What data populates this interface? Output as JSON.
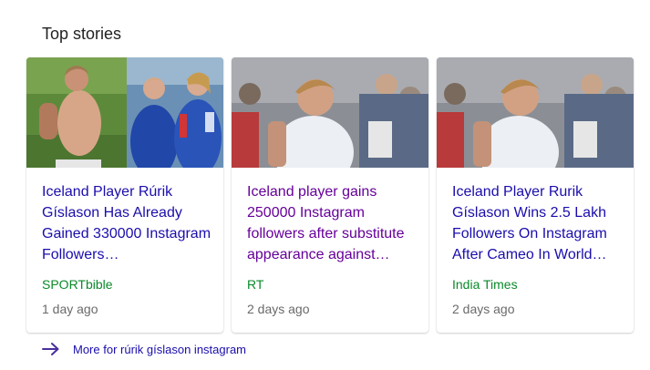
{
  "section": {
    "title": "Top stories"
  },
  "cards": [
    {
      "headline": "Iceland Player Rúrik Gíslason Has Already Gained 330000 Instagram Followers…",
      "source": "SPORTbible",
      "age": "1 day ago",
      "visited": false
    },
    {
      "headline": "Iceland player gains 250000 Instagram followers after substitute appearance against…",
      "source": "RT",
      "age": "2 days ago",
      "visited": true
    },
    {
      "headline": "Iceland Player Rurik Gíslason Wins 2.5 Lakh Followers On Instagram After Cameo In World…",
      "source": "India Times",
      "age": "2 days ago",
      "visited": false
    }
  ],
  "more": {
    "label": "More for rúrik gíslason instagram",
    "icon": "arrow-right-icon"
  },
  "colors": {
    "link": "#1a0dab",
    "visited": "#660099",
    "source": "#0a8a2a",
    "meta": "#6a6a6a"
  }
}
